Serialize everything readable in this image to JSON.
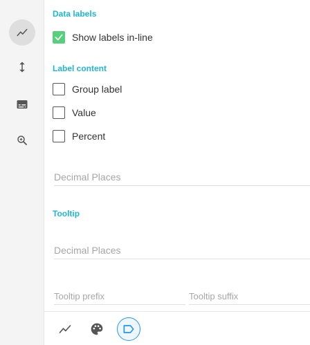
{
  "rail": {
    "items": [
      {
        "icon": "trend-line-icon",
        "active": true
      },
      {
        "icon": "vertical-resize-icon",
        "active": false
      },
      {
        "icon": "subtitles-icon",
        "active": false
      },
      {
        "icon": "zoom-in-icon",
        "active": false
      }
    ]
  },
  "data_labels": {
    "heading": "Data labels",
    "show_inline_label": "Show labels in-line",
    "show_inline_checked": true
  },
  "label_content": {
    "heading": "Label content",
    "options": [
      {
        "label": "Group label",
        "checked": false
      },
      {
        "label": "Value",
        "checked": false
      },
      {
        "label": "Percent",
        "checked": false
      }
    ],
    "decimal_places": {
      "value": "",
      "placeholder": "Decimal Places"
    }
  },
  "tooltip": {
    "heading": "Tooltip",
    "decimal_places": {
      "value": "",
      "placeholder": "Decimal Places"
    },
    "prefix": {
      "value": "",
      "placeholder": "Tooltip prefix"
    },
    "suffix": {
      "value": "",
      "placeholder": "Tooltip suffix"
    }
  },
  "bottom_tabs": [
    {
      "icon": "trend-line-icon",
      "active": false
    },
    {
      "icon": "palette-icon",
      "active": false
    },
    {
      "icon": "label-tag-icon",
      "active": true
    }
  ],
  "colors": {
    "accent": "#1fb6d4",
    "check_green": "#58cf7c",
    "active_tab_border": "#2196f3"
  }
}
